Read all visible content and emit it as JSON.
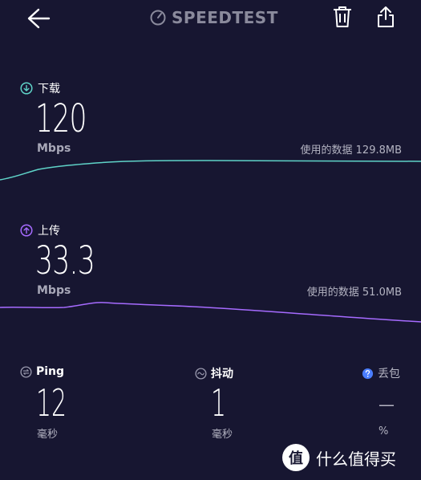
{
  "app": {
    "title": "SPEEDTEST"
  },
  "download": {
    "label": "下载",
    "value": "120",
    "unit": "Mbps",
    "data_used": "使用的数据 129.8MB",
    "color": "#5fd3c8"
  },
  "upload": {
    "label": "上传",
    "value": "33.3",
    "unit": "Mbps",
    "data_used": "使用的数据 51.0MB",
    "color": "#a66bff"
  },
  "ping": {
    "label": "Ping",
    "value": "12",
    "unit": "毫秒"
  },
  "jitter": {
    "label": "抖动",
    "value": "1",
    "unit": "毫秒"
  },
  "loss": {
    "label": "丢包",
    "value": "—",
    "unit": "%"
  },
  "watermark": {
    "text": "什么值得买",
    "logo_char": "值"
  },
  "icons": {
    "back": "back-arrow-icon",
    "logo": "speedometer-icon",
    "trash": "trash-icon",
    "share": "share-icon"
  }
}
